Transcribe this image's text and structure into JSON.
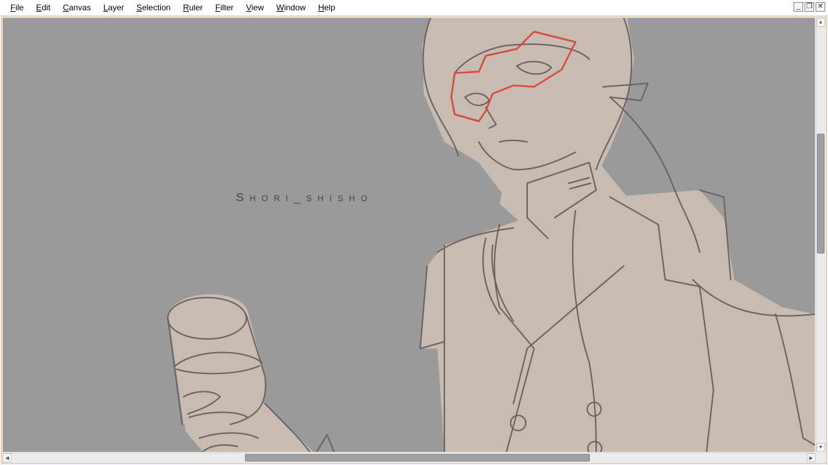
{
  "menubar": {
    "items": [
      "File",
      "Edit",
      "Canvas",
      "Layer",
      "Selection",
      "Ruler",
      "Filter",
      "View",
      "Window",
      "Help"
    ]
  },
  "window_controls": {
    "minimize": "minimize-icon",
    "restore": "restore-icon",
    "close": "close-icon"
  },
  "canvas": {
    "background_color": "#9a9a9a",
    "watermark": "Shori_shisho",
    "sketch_color": "#6e6060",
    "fill_color": "#c8bcb2",
    "mask_color": "#d9483b"
  },
  "scrollbars": {
    "vertical_up": "scroll-up-arrow-icon",
    "vertical_down": "scroll-down-arrow-icon",
    "horizontal_left": "scroll-left-arrow-icon",
    "horizontal_right": "scroll-right-arrow-icon"
  }
}
